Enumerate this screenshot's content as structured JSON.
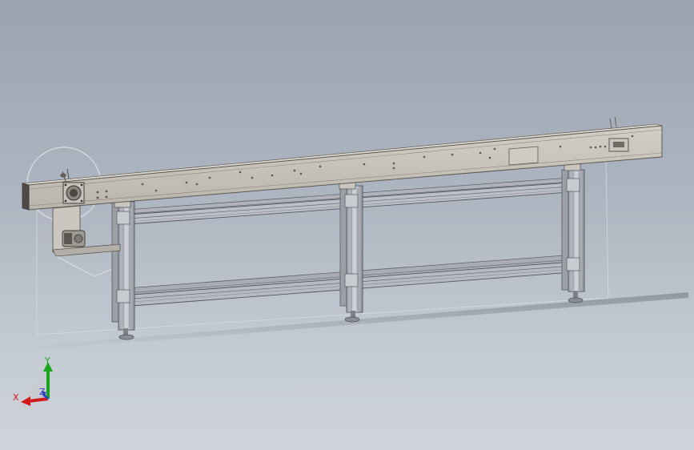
{
  "viewport": {
    "background_top": "#9aa3b0",
    "background_bottom": "#cfd4da"
  },
  "model": {
    "frame_color": "#c5c0b8",
    "frame_dark": "#6e6a64",
    "leg_color": "#b9bcc2",
    "leg_dark": "#5e6168",
    "motor_color": "#b8b4ad"
  },
  "triad": {
    "x_label": "X",
    "y_label": "Y",
    "z_label": "Z",
    "x_color": "#d11a1a",
    "y_color": "#1aa61a",
    "z_color": "#3040c8"
  }
}
